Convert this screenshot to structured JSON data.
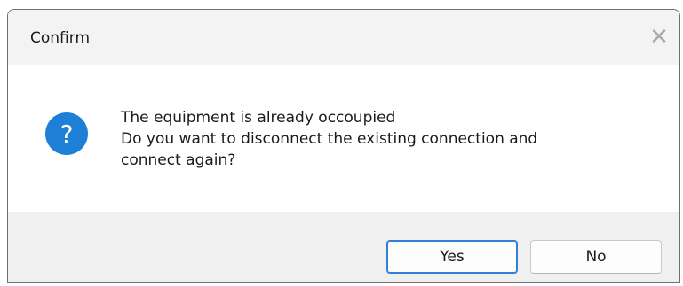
{
  "window": {
    "title": "Confirm",
    "close_glyph": "✕"
  },
  "message": {
    "icon": "question-icon",
    "icon_color": "#1e7fd6",
    "icon_glyph": "?",
    "line1": "The equipment is already occoupied",
    "line2": "Do you want to disconnect the existing connection and",
    "line3": "connect again?"
  },
  "buttons": {
    "yes_label": "Yes",
    "no_label": "No",
    "default_accent": "#2f7ed8"
  }
}
